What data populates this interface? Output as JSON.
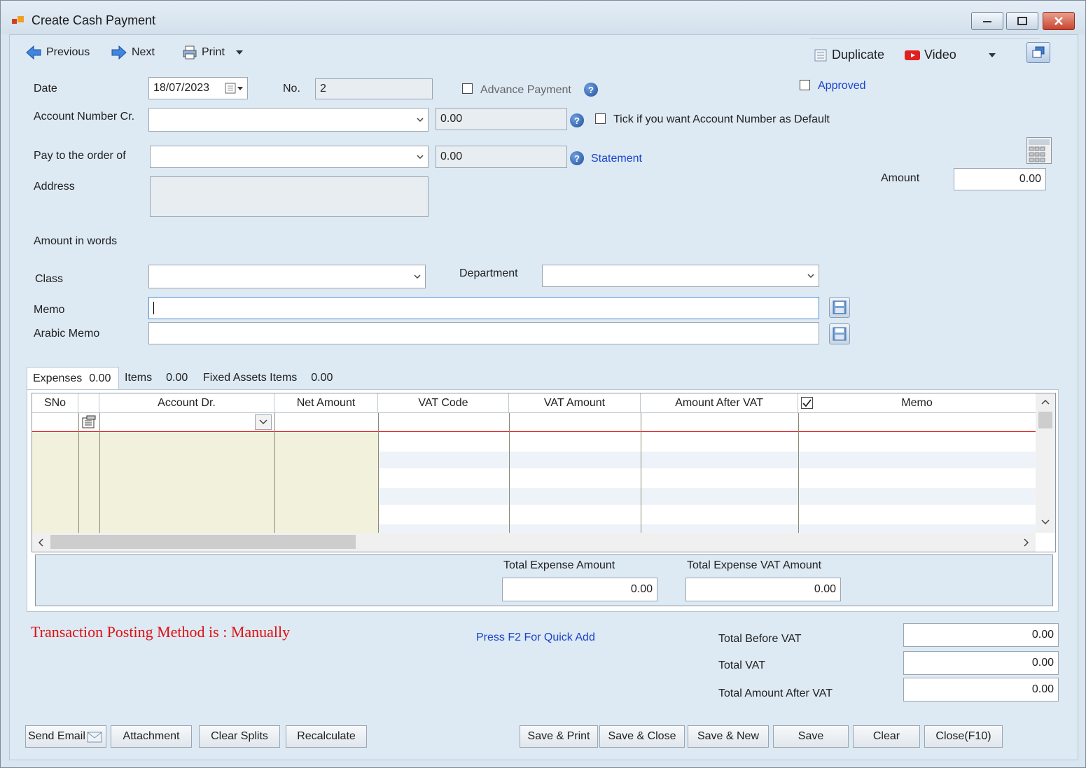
{
  "window": {
    "title": "Create Cash Payment"
  },
  "toolbar": {
    "previous": "Previous",
    "next": "Next",
    "print": "Print",
    "duplicate": "Duplicate",
    "video": "Video"
  },
  "form": {
    "date_label": "Date",
    "date_value": "18/07/2023",
    "no_label": "No.",
    "no_value": "2",
    "advance_payment": "Advance Payment",
    "approved": "Approved",
    "account_cr_label": "Account Number Cr.",
    "account_cr_balance": "0.00",
    "default_account": "Tick if you want Account Number as Default",
    "pay_to_label": "Pay to the order of",
    "pay_to_balance": "0.00",
    "statement": "Statement",
    "address_label": "Address",
    "amount_label": "Amount",
    "amount_value": "0.00",
    "amount_words_label": "Amount in words",
    "class_label": "Class",
    "department_label": "Department",
    "memo_label": "Memo",
    "arabic_memo_label": "Arabic Memo"
  },
  "tabs": [
    {
      "label": "Expenses",
      "value": "0.00"
    },
    {
      "label": "Items",
      "value": "0.00"
    },
    {
      "label": "Fixed Assets Items",
      "value": "0.00"
    }
  ],
  "grid": {
    "columns": [
      "SNo",
      "Account Dr.",
      "Net Amount",
      "VAT Code",
      "VAT Amount",
      "Amount After VAT",
      "Memo"
    ]
  },
  "expense_totals": {
    "total_expense_label": "Total Expense Amount",
    "total_expense_value": "0.00",
    "total_vat_label": "Total Expense VAT Amount",
    "total_vat_value": "0.00"
  },
  "footer": {
    "posting_method": "Transaction Posting Method is : Manually",
    "quick_add": "Press F2 For Quick Add",
    "total_before_vat_label": "Total Before VAT",
    "total_before_vat_value": "0.00",
    "total_vat_label": "Total VAT",
    "total_vat_value": "0.00",
    "total_after_vat_label": "Total Amount After VAT",
    "total_after_vat_value": "0.00"
  },
  "buttons": {
    "send_email": "Send Email",
    "attachment": "Attachment",
    "clear_splits": "Clear Splits",
    "recalculate": "Recalculate",
    "save_print": "Save & Print",
    "save_close": "Save & Close",
    "save_new": "Save & New",
    "save": "Save",
    "clear": "Clear",
    "close": "Close(F10)"
  },
  "colors": {
    "accent_link": "#1a44c8",
    "posting_red": "#e01010",
    "grid_tint": "#f1f1dc"
  }
}
